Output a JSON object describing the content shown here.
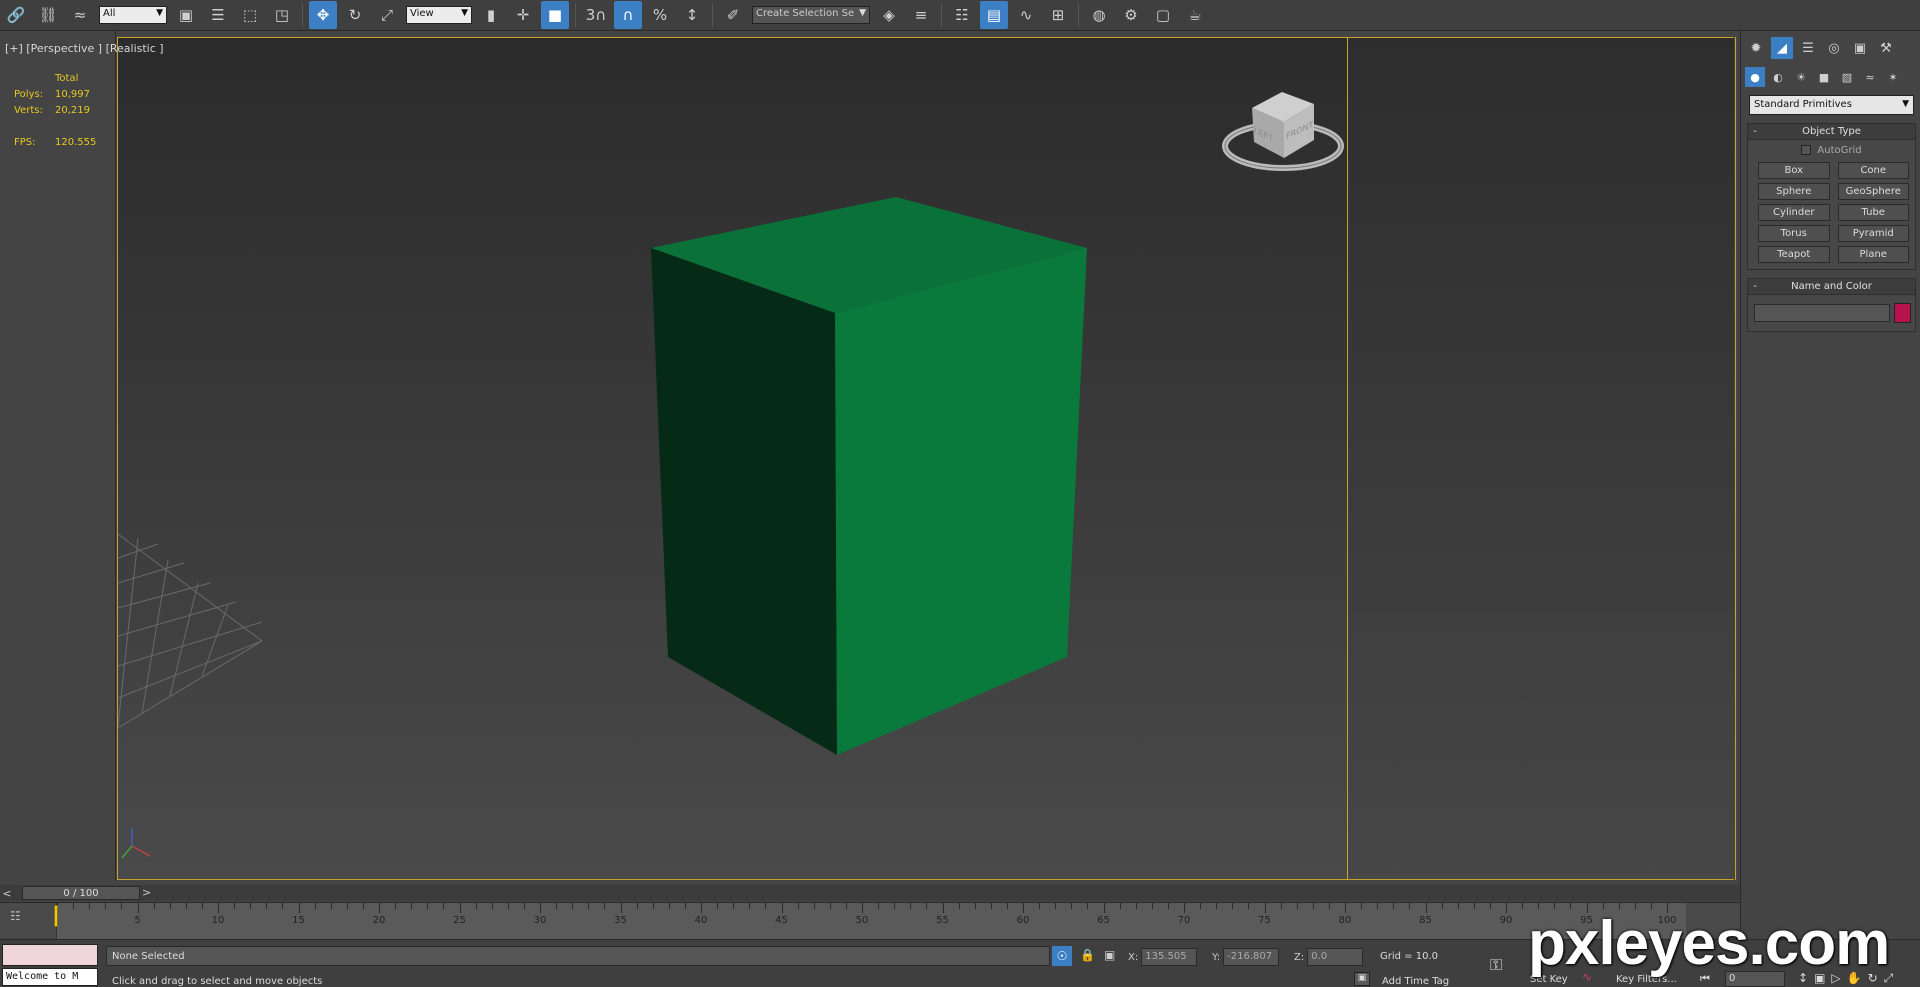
{
  "toolbar": {
    "selection_filter": "All",
    "ref_coord": "View",
    "named_selection": "Create Selection Se",
    "snap_count": "3",
    "percent_snap": "%"
  },
  "viewport": {
    "label": "[+] [Perspective ] [Realistic ]",
    "stats": {
      "header": "Total",
      "polys_label": "Polys:",
      "polys_value": "10,997",
      "verts_label": "Verts:",
      "verts_value": "20,219",
      "fps_label": "FPS:",
      "fps_value": "120.555"
    },
    "viewcube_labels": {
      "left": "LEFT",
      "front": "FRONT"
    },
    "box_colors": {
      "top": "#0a7239",
      "front": "#097a3c",
      "left": "#052a16"
    }
  },
  "command_panel": {
    "category": "Standard Primitives",
    "object_type_title": "Object Type",
    "autogrid_label": "AutoGrid",
    "primitives": [
      "Box",
      "Cone",
      "Sphere",
      "GeoSphere",
      "Cylinder",
      "Tube",
      "Torus",
      "Pyramid",
      "Teapot",
      "Plane"
    ],
    "name_color_title": "Name and Color",
    "object_color": "#b5124e"
  },
  "timeline": {
    "frame_display": "0 / 100",
    "ticks": [
      "5",
      "10",
      "15",
      "20",
      "25",
      "30",
      "35",
      "40",
      "45",
      "50",
      "55",
      "60",
      "65",
      "70",
      "75",
      "80",
      "85",
      "90",
      "95",
      "100"
    ]
  },
  "status": {
    "maxscript_text": "Welcome to M",
    "selection_status": "None Selected",
    "prompt": "Click and drag to select and move objects",
    "x_label": "X:",
    "x_value": "135.505",
    "y_label": "Y:",
    "y_value": "-216.807",
    "z_label": "Z:",
    "z_value": "0.0",
    "grid": "Grid = 10.0",
    "add_time_tag": "Add Time Tag",
    "set_key": "Set Key",
    "key_filters": "Key Filters...",
    "current_frame": "0"
  },
  "watermark": "pxleyes.com"
}
